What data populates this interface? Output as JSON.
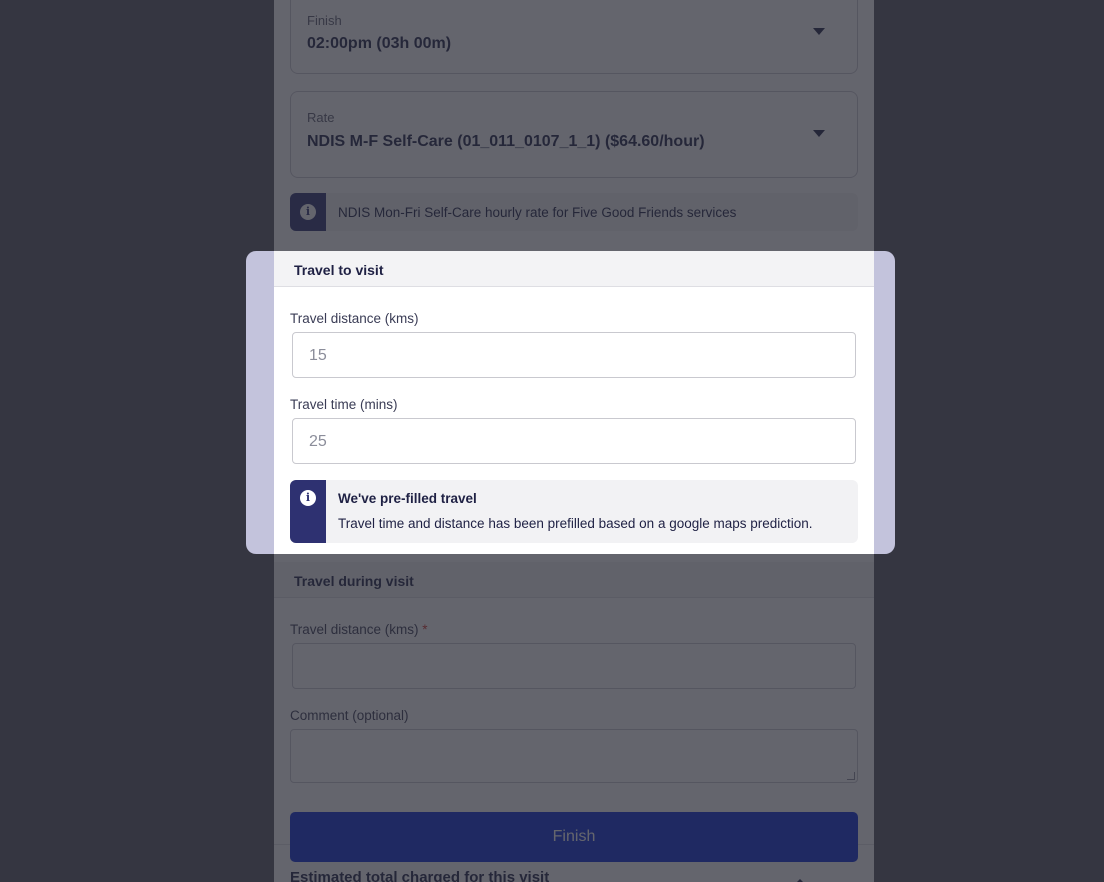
{
  "finish_select": {
    "label": "Finish",
    "value": "02:00pm (03h 00m)"
  },
  "rate_select": {
    "label": "Rate",
    "value": "NDIS M-F Self-Care (01_011_0107_1_1) ($64.60/hour)"
  },
  "rate_info": {
    "text": "NDIS Mon-Fri Self-Care hourly rate for Five Good Friends services"
  },
  "travel_to_visit": {
    "heading": "Travel to visit",
    "distance_label": "Travel distance (kms)",
    "distance_value": "15",
    "time_label": "Travel time (mins)",
    "time_value": "25",
    "notice_title": "We've pre-filled travel",
    "notice_body": "Travel time and distance has been prefilled based on a google maps prediction."
  },
  "travel_during_visit": {
    "heading": "Travel during visit",
    "distance_label": "Travel distance (kms)",
    "required_mark": "*",
    "distance_value": "",
    "comment_label": "Comment (optional)",
    "comment_value": ""
  },
  "finish_button": {
    "label": "Finish"
  },
  "estimate": {
    "label": "Estimated total charged for this visit"
  },
  "icons": {
    "info": "info-icon",
    "caret": "caret-down-icon"
  },
  "colors": {
    "primary": "#0a2ad6",
    "info_side": "#2e3171",
    "highlight": "#c3c3dc"
  }
}
